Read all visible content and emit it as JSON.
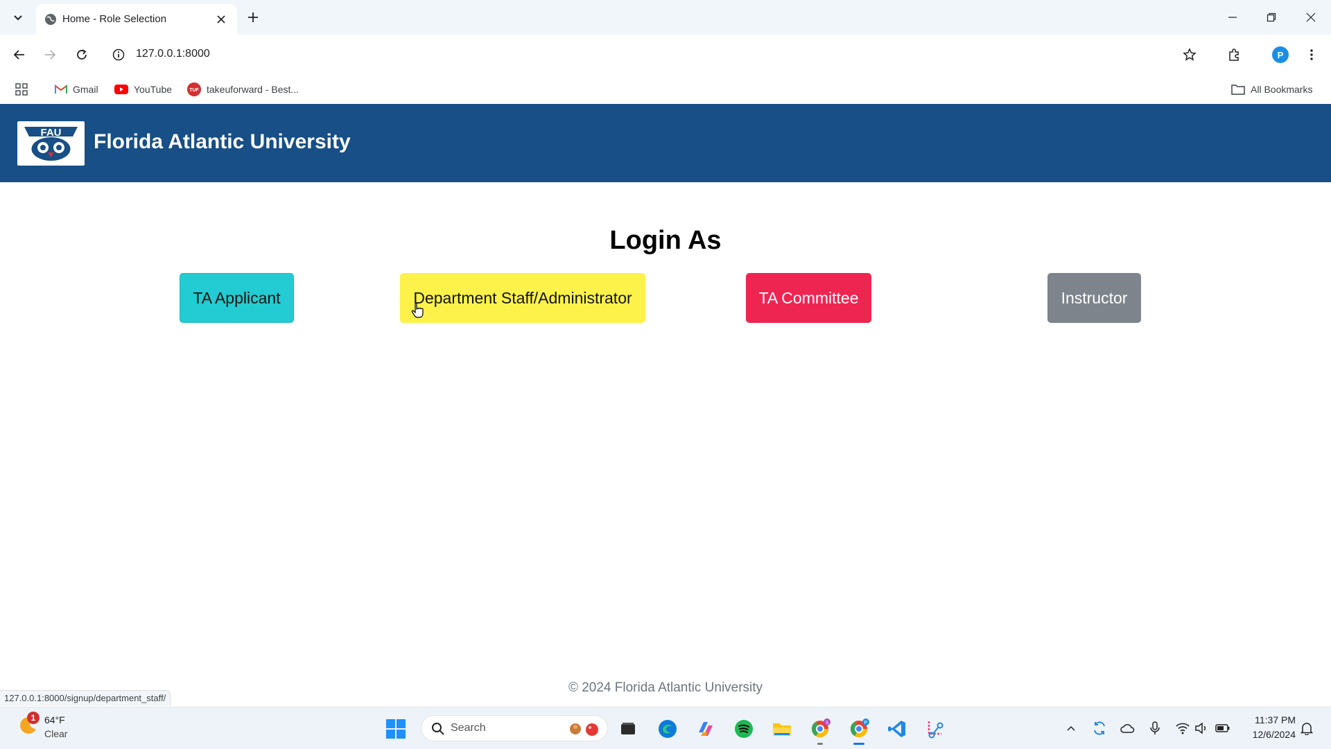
{
  "browser": {
    "tab_title": "Home - Role Selection",
    "url": "127.0.0.1:8000",
    "bookmarks": [
      {
        "label": "Gmail",
        "icon": "gmail-icon"
      },
      {
        "label": "YouTube",
        "icon": "youtube-icon"
      },
      {
        "label": "takeuforward - Best...",
        "icon": "takeuforward-icon"
      }
    ],
    "all_bookmarks_label": "All Bookmarks",
    "profile_initial": "P",
    "status_url": "127.0.0.1:8000/signup/department_staff/"
  },
  "header": {
    "logo_text": "FAU",
    "title": "Florida Atlantic University",
    "background": "#174f86"
  },
  "main": {
    "heading": "Login As",
    "roles": [
      {
        "label": "TA Applicant",
        "color": "#22ccd2"
      },
      {
        "label": "Department Staff/Administrator",
        "color": "#fdf24a"
      },
      {
        "label": "TA Committee",
        "color": "#ee2551"
      },
      {
        "label": "Instructor",
        "color": "#7d848b"
      }
    ]
  },
  "footer": {
    "text": "© 2024 Florida Atlantic University"
  },
  "taskbar": {
    "weather_temp": "64°F",
    "weather_condition": "Clear",
    "weather_badge": "1",
    "search_placeholder": "Search",
    "time": "11:37 PM",
    "date": "12/6/2024"
  }
}
